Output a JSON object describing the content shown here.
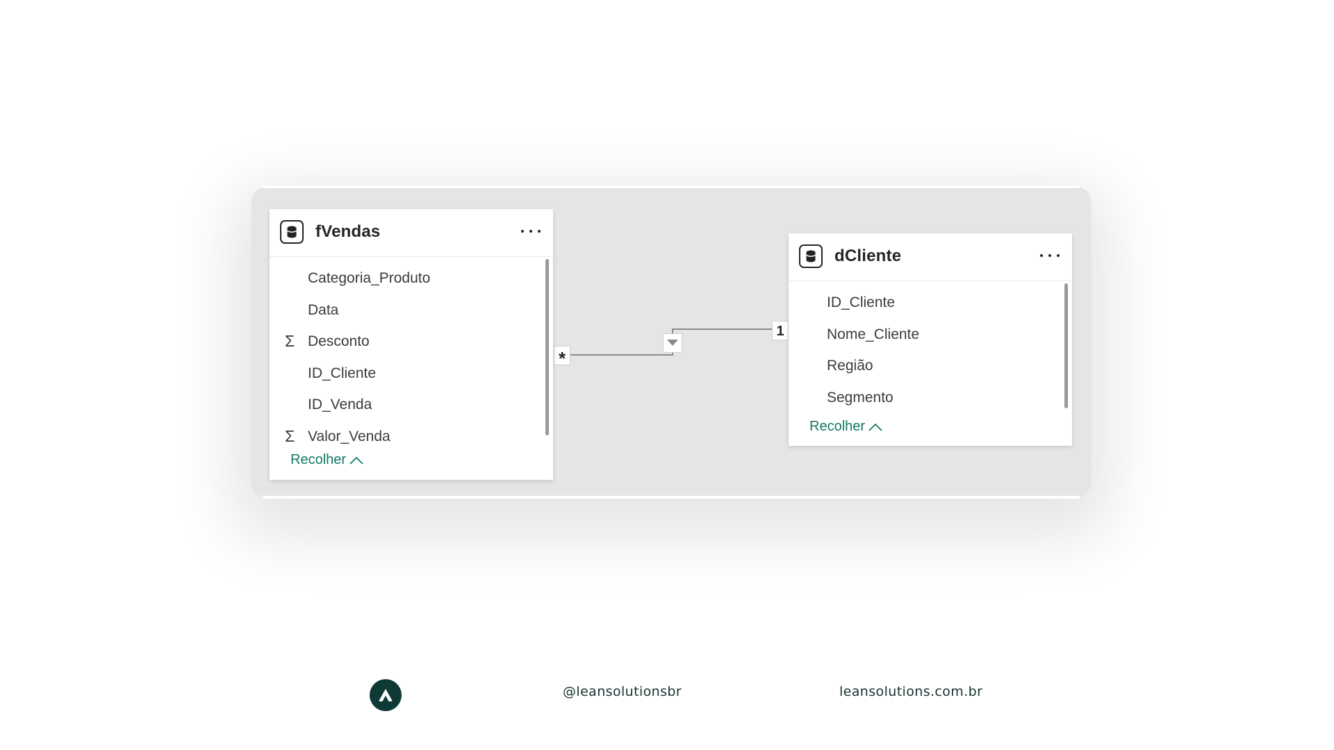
{
  "tables": [
    {
      "title": "fVendas",
      "fields": [
        {
          "label": "Categoria_Produto",
          "sigma": ""
        },
        {
          "label": "Data",
          "sigma": ""
        },
        {
          "label": "Desconto",
          "sigma": "Σ"
        },
        {
          "label": "ID_Cliente",
          "sigma": ""
        },
        {
          "label": "ID_Venda",
          "sigma": ""
        },
        {
          "label": "Valor_Venda",
          "sigma": "Σ"
        }
      ],
      "collapse_label": "Recolher"
    },
    {
      "title": "dCliente",
      "fields": [
        {
          "label": "ID_Cliente"
        },
        {
          "label": "Nome_Cliente"
        },
        {
          "label": "Região"
        },
        {
          "label": "Segmento"
        }
      ],
      "collapse_label": "Recolher"
    }
  ],
  "relationship": {
    "from_cardinality": "*",
    "to_cardinality": "1",
    "filter_direction": "single"
  },
  "footer": {
    "handle": "@leansolutionsbr",
    "site": "leansolutions.com.br"
  },
  "icons": {
    "table": "database-icon",
    "more": "more-options-icon",
    "collapse": "chevron-up-icon",
    "filter": "triangle-down-icon",
    "logo": "lean-solutions-logo"
  },
  "colors": {
    "accent": "#117865",
    "canvas": "#e6e5e4",
    "footer_logo": "#0e3a36"
  }
}
